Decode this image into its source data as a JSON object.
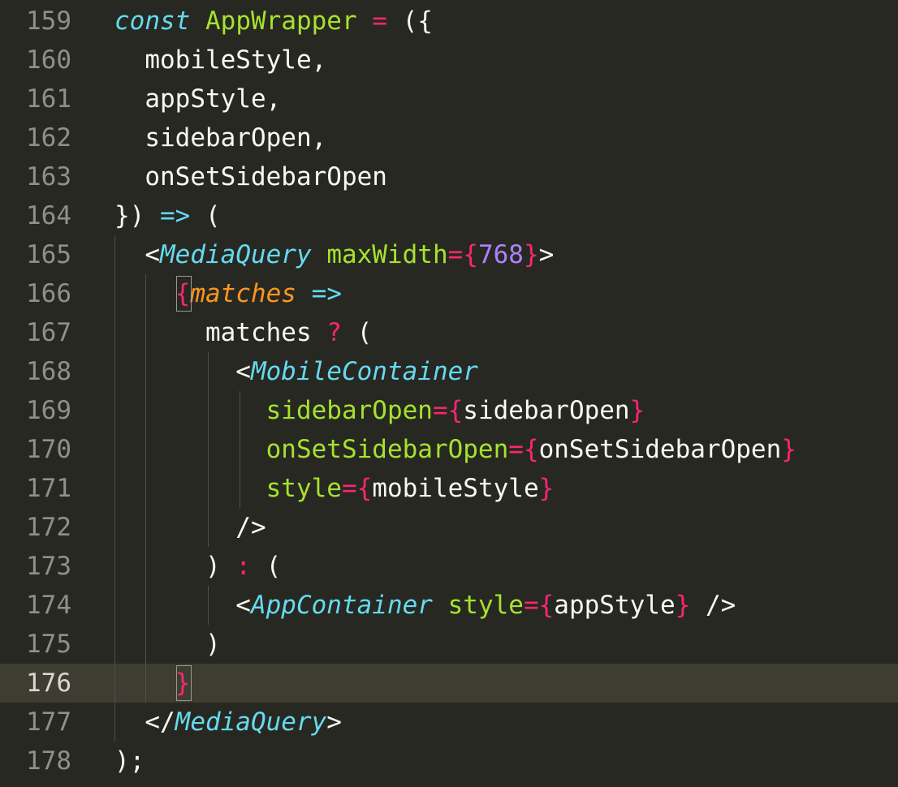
{
  "editor": {
    "active_line": 176,
    "lines": [
      {
        "n": "159",
        "tokens": [
          {
            "t": "const",
            "c": "k"
          },
          {
            "t": " ",
            "c": "pl"
          },
          {
            "t": "AppWrapper",
            "c": "fn"
          },
          {
            "t": " ",
            "c": "pl"
          },
          {
            "t": "=",
            "c": "op"
          },
          {
            "t": " ({",
            "c": "pl"
          }
        ]
      },
      {
        "n": "160",
        "tokens": [
          {
            "t": "  mobileStyle,",
            "c": "pl"
          }
        ]
      },
      {
        "n": "161",
        "tokens": [
          {
            "t": "  appStyle,",
            "c": "pl"
          }
        ]
      },
      {
        "n": "162",
        "tokens": [
          {
            "t": "  sidebarOpen,",
            "c": "pl"
          }
        ]
      },
      {
        "n": "163",
        "tokens": [
          {
            "t": "  onSetSidebarOpen",
            "c": "pl"
          }
        ]
      },
      {
        "n": "164",
        "tokens": [
          {
            "t": "}) ",
            "c": "pl"
          },
          {
            "t": "=>",
            "c": "ar"
          },
          {
            "t": " (",
            "c": "pl"
          }
        ]
      },
      {
        "n": "165",
        "tokens": [
          {
            "t": "  <",
            "c": "pl"
          },
          {
            "t": "MediaQuery",
            "c": "cm"
          },
          {
            "t": " ",
            "c": "pl"
          },
          {
            "t": "maxWidth",
            "c": "at"
          },
          {
            "t": "=",
            "c": "op"
          },
          {
            "t": "{",
            "c": "op"
          },
          {
            "t": "768",
            "c": "nu"
          },
          {
            "t": "}",
            "c": "op"
          },
          {
            "t": ">",
            "c": "pl"
          }
        ]
      },
      {
        "n": "166",
        "tokens": [
          {
            "t": "    ",
            "c": "pl"
          },
          {
            "t": "{",
            "c": "op"
          },
          {
            "t": "matches",
            "c": "pa"
          },
          {
            "t": " ",
            "c": "pl"
          },
          {
            "t": "=>",
            "c": "ar"
          }
        ]
      },
      {
        "n": "167",
        "tokens": [
          {
            "t": "      matches ",
            "c": "pl"
          },
          {
            "t": "?",
            "c": "op"
          },
          {
            "t": " (",
            "c": "pl"
          }
        ]
      },
      {
        "n": "168",
        "tokens": [
          {
            "t": "        <",
            "c": "pl"
          },
          {
            "t": "MobileContainer",
            "c": "cm"
          }
        ]
      },
      {
        "n": "169",
        "tokens": [
          {
            "t": "          ",
            "c": "pl"
          },
          {
            "t": "sidebarOpen",
            "c": "at"
          },
          {
            "t": "=",
            "c": "op"
          },
          {
            "t": "{",
            "c": "op"
          },
          {
            "t": "sidebarOpen",
            "c": "pl"
          },
          {
            "t": "}",
            "c": "op"
          }
        ]
      },
      {
        "n": "170",
        "tokens": [
          {
            "t": "          ",
            "c": "pl"
          },
          {
            "t": "onSetSidebarOpen",
            "c": "at"
          },
          {
            "t": "=",
            "c": "op"
          },
          {
            "t": "{",
            "c": "op"
          },
          {
            "t": "onSetSidebarOpen",
            "c": "pl"
          },
          {
            "t": "}",
            "c": "op"
          }
        ]
      },
      {
        "n": "171",
        "tokens": [
          {
            "t": "          ",
            "c": "pl"
          },
          {
            "t": "style",
            "c": "at"
          },
          {
            "t": "=",
            "c": "op"
          },
          {
            "t": "{",
            "c": "op"
          },
          {
            "t": "mobileStyle",
            "c": "pl"
          },
          {
            "t": "}",
            "c": "op"
          }
        ]
      },
      {
        "n": "172",
        "tokens": [
          {
            "t": "        />",
            "c": "pl"
          }
        ]
      },
      {
        "n": "173",
        "tokens": [
          {
            "t": "      ) ",
            "c": "pl"
          },
          {
            "t": ":",
            "c": "op"
          },
          {
            "t": " (",
            "c": "pl"
          }
        ]
      },
      {
        "n": "174",
        "tokens": [
          {
            "t": "        <",
            "c": "pl"
          },
          {
            "t": "AppContainer",
            "c": "cm"
          },
          {
            "t": " ",
            "c": "pl"
          },
          {
            "t": "style",
            "c": "at"
          },
          {
            "t": "=",
            "c": "op"
          },
          {
            "t": "{",
            "c": "op"
          },
          {
            "t": "appStyle",
            "c": "pl"
          },
          {
            "t": "}",
            "c": "op"
          },
          {
            "t": " />",
            "c": "pl"
          }
        ]
      },
      {
        "n": "175",
        "tokens": [
          {
            "t": "      )",
            "c": "pl"
          }
        ]
      },
      {
        "n": "176",
        "tokens": [
          {
            "t": "    ",
            "c": "pl"
          },
          {
            "t": "}",
            "c": "op"
          }
        ]
      },
      {
        "n": "177",
        "tokens": [
          {
            "t": "  </",
            "c": "pl"
          },
          {
            "t": "MediaQuery",
            "c": "cm"
          },
          {
            "t": ">",
            "c": "pl"
          }
        ]
      },
      {
        "n": "178",
        "tokens": [
          {
            "t": ");",
            "c": "pl"
          }
        ]
      }
    ]
  },
  "colors": {
    "background": "#272822",
    "active_line": "#3e3d32",
    "keyword": "#66d9ef",
    "function": "#a6e22e",
    "operator": "#f92672",
    "number": "#ae81ff",
    "parameter": "#fd971f",
    "text": "#f8f8f2",
    "line_number": "#90908a"
  }
}
